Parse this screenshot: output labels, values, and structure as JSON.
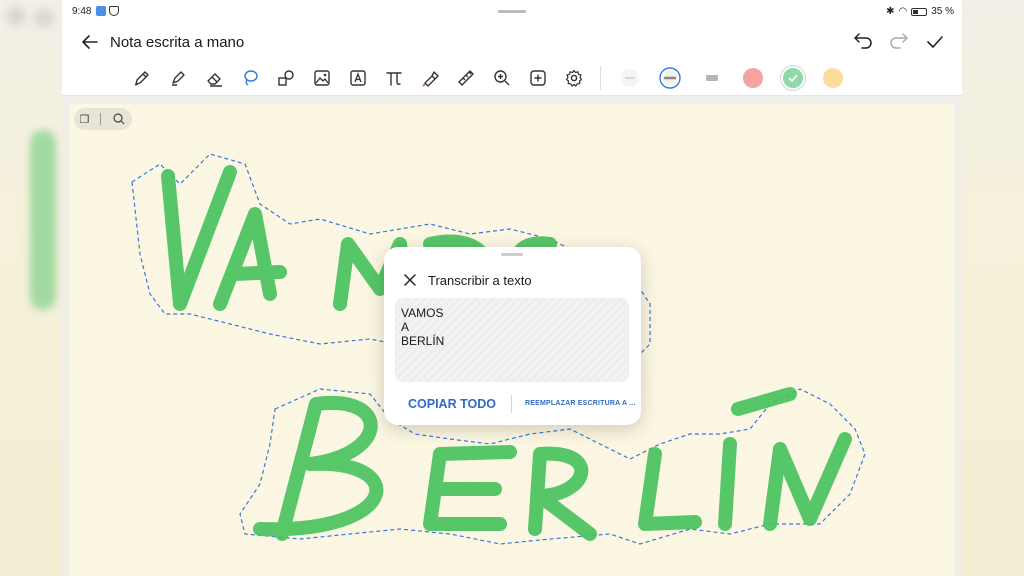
{
  "status_bar": {
    "time": "9:48",
    "battery": "35 %"
  },
  "header": {
    "title": "Nota escrita a mano"
  },
  "toolbar": {
    "tools": [
      "pen-icon",
      "highlighter-icon",
      "eraser-icon",
      "lasso-icon",
      "shapes-icon",
      "image-icon",
      "text-box-icon",
      "formula-icon",
      "color-picker-icon",
      "ruler-icon",
      "zoom-icon",
      "add-icon",
      "settings-icon"
    ],
    "colors": [
      "#eeeeee",
      "#c9cdd6",
      "#d0d0d0",
      "#f4a3a3",
      "#8fd9a8",
      "#fbdc9a"
    ]
  },
  "handwriting": {
    "line1": "VAMOS",
    "line2": "BERLÍN",
    "stroke_color": "#46c15c",
    "selection_color": "#3a78d8"
  },
  "popup": {
    "title": "Transcribir a texto",
    "lines": [
      "VAMOS",
      "A",
      "BERLÍN"
    ],
    "copy_label": "COPIAR TODO",
    "replace_label": "REEMPLAZAR ESCRITURA A ..."
  }
}
